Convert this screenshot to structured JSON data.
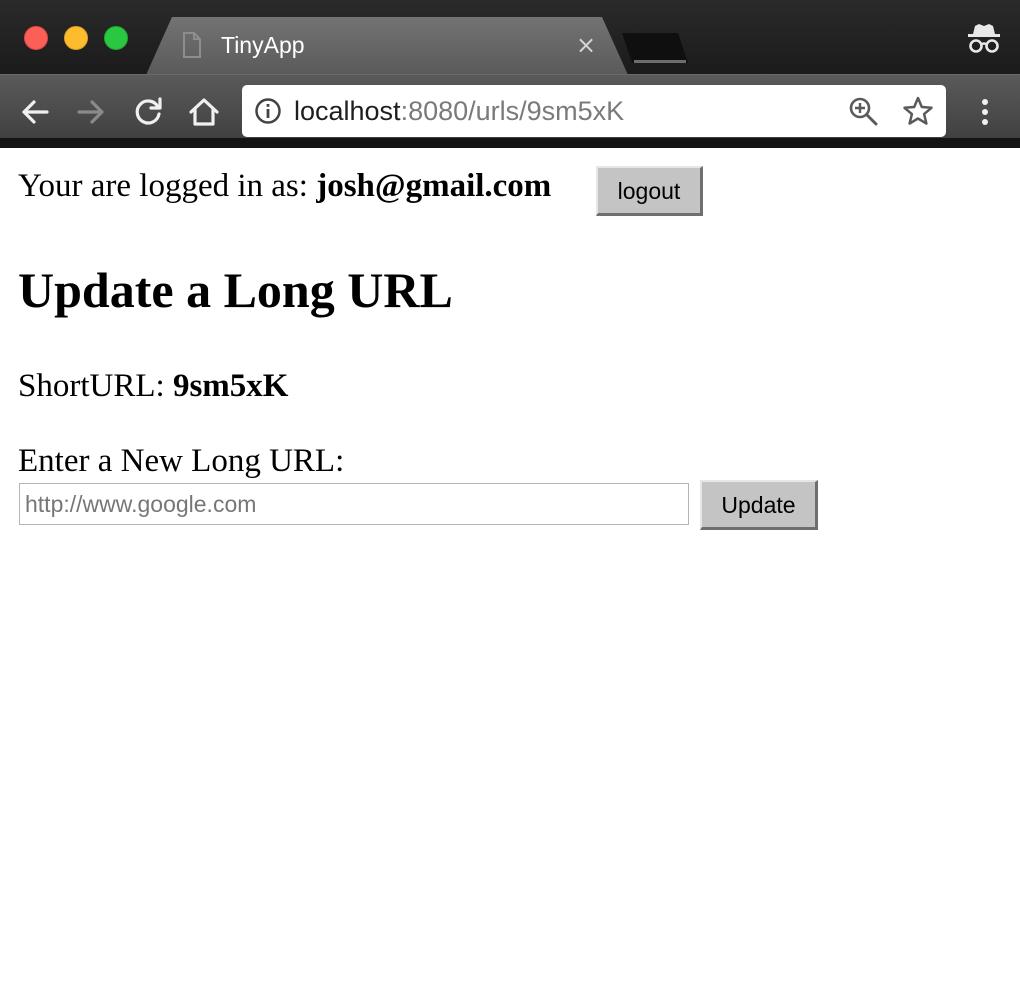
{
  "browser": {
    "tab_title": "TinyApp",
    "tab_close": "×",
    "url_host": "localhost",
    "url_rest": ":8080/urls/9sm5xK",
    "icons": {
      "back": "back-arrow-icon",
      "forward": "forward-arrow-icon",
      "reload": "reload-icon",
      "home": "home-icon",
      "info": "info-icon",
      "zoom": "zoom-icon",
      "bookmark": "star-icon",
      "menu": "kebab-menu-icon",
      "incognito": "incognito-icon",
      "tab_page": "document-icon"
    },
    "colors": {
      "traffic_red": "#fc5f57",
      "traffic_yellow": "#fdbc2e",
      "traffic_green": "#2ac840"
    }
  },
  "page": {
    "login_prefix": "Your are logged in as:",
    "login_email": "josh@gmail.com",
    "logout_label": "logout",
    "heading": "Update a Long URL",
    "shorturl_label": "ShortURL:",
    "shorturl_value": "9sm5xK",
    "new_url_label": "Enter a New Long URL:",
    "new_url_placeholder": "http://www.google.com",
    "new_url_value": "",
    "update_label": "Update"
  }
}
